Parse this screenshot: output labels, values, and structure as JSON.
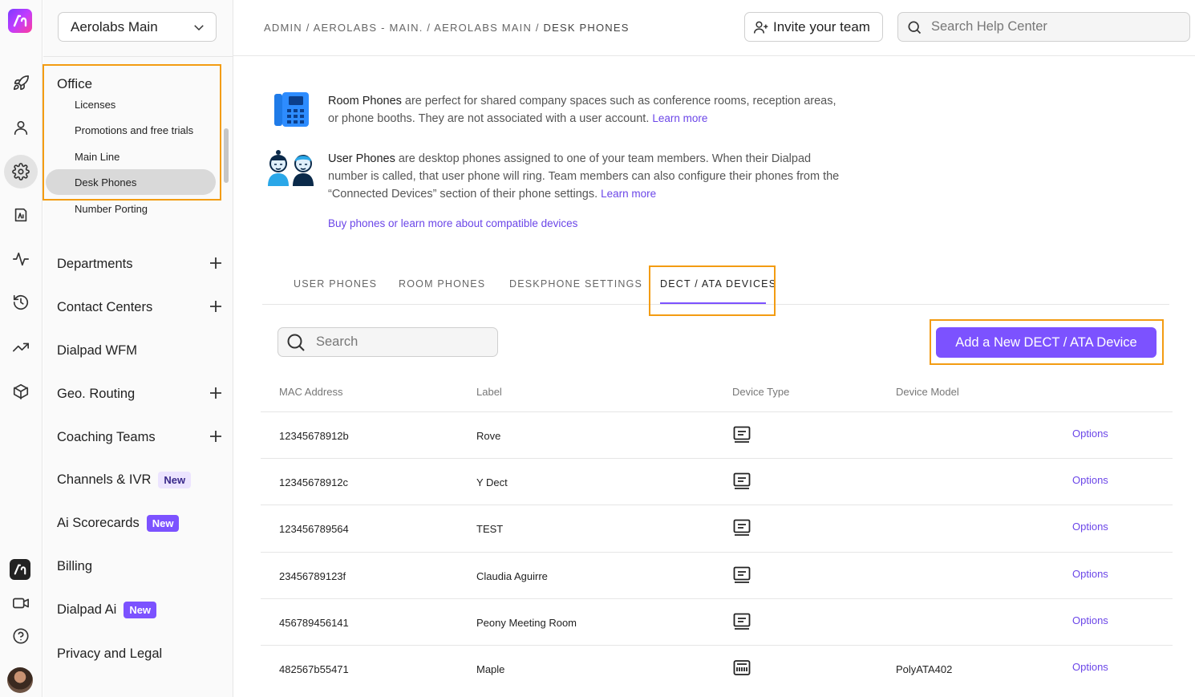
{
  "sidebar": {
    "org_select": "Aerolabs Main",
    "office_title": "Office",
    "office_items": [
      {
        "label": "Licenses"
      },
      {
        "label": "Promotions and free trials"
      },
      {
        "label": "Main Line"
      },
      {
        "label": "Desk Phones"
      },
      {
        "label": "Number Porting"
      }
    ],
    "nav": [
      {
        "label": "Departments",
        "expandable": true
      },
      {
        "label": "Contact Centers",
        "expandable": true
      },
      {
        "label": "Dialpad WFM"
      },
      {
        "label": "Geo. Routing",
        "expandable": true
      },
      {
        "label": "Coaching Teams",
        "expandable": true
      },
      {
        "label": "Channels & IVR",
        "badge": "New"
      },
      {
        "label": "Ai Scorecards",
        "badge": "New"
      },
      {
        "label": "Billing"
      },
      {
        "label": "Dialpad Ai",
        "badge": "New"
      },
      {
        "label": "Privacy and Legal"
      }
    ]
  },
  "rail": {
    "icons": [
      "dialpad-logo",
      "rocket-icon",
      "user-icon",
      "gear-icon",
      "contacts-icon",
      "analytics-icon",
      "history-icon",
      "trending-icon",
      "box-icon",
      "dialpad-app-icon",
      "video-icon",
      "help-icon",
      "avatar"
    ]
  },
  "header": {
    "breadcrumb": {
      "path": "ADMIN / AEROLABS - MAIN. / AEROLABS MAIN /",
      "current": "DESK PHONES"
    },
    "invite_label": "Invite your team",
    "help_search_placeholder": "Search Help Center"
  },
  "info": {
    "room": {
      "lead": "Room Phones",
      "text": " are perfect for shared company spaces such as conference rooms, reception areas, or phone booths. They are not associated with a user account. ",
      "link": "Learn more"
    },
    "user": {
      "lead": "User Phones",
      "text": " are desktop phones assigned to one of your team members. When their Dialpad number is called, that user phone will ring. Team members can also configure their phones from the “Connected Devices” section of their phone settings. ",
      "link": "Learn more"
    },
    "buy_link": "Buy phones or learn more about compatible devices"
  },
  "tabs": [
    {
      "label": "USER PHONES"
    },
    {
      "label": "ROOM PHONES"
    },
    {
      "label": "DESKPHONE SETTINGS"
    },
    {
      "label": "DECT / ATA DEVICES",
      "active": true
    }
  ],
  "toolbar": {
    "search_placeholder": "Search",
    "add_button": "Add a New DECT / ATA Device"
  },
  "table": {
    "headers": [
      "MAC Address",
      "Label",
      "Device Type",
      "Device Model"
    ],
    "rows": [
      {
        "mac": "12345678912b",
        "label": "Rove",
        "type": "dect-icon",
        "model": "",
        "options": "Options"
      },
      {
        "mac": "12345678912c",
        "label": "Y Dect",
        "type": "dect-icon",
        "model": "",
        "options": "Options"
      },
      {
        "mac": "123456789564",
        "label": "TEST",
        "type": "dect-icon",
        "model": "",
        "options": "Options"
      },
      {
        "mac": "23456789123f",
        "label": "Claudia Aguirre",
        "type": "dect-icon",
        "model": "",
        "options": "Options"
      },
      {
        "mac": "456789456141",
        "label": "Peony Meeting Room",
        "type": "dect-icon",
        "model": "",
        "options": "Options"
      },
      {
        "mac": "482567b55471",
        "label": "Maple",
        "type": "ata-icon",
        "model": "PolyATA402",
        "options": "Options"
      }
    ]
  },
  "colors": {
    "accent": "#7c52ff",
    "link": "#6b46e8",
    "highlight": "#f39c12"
  }
}
